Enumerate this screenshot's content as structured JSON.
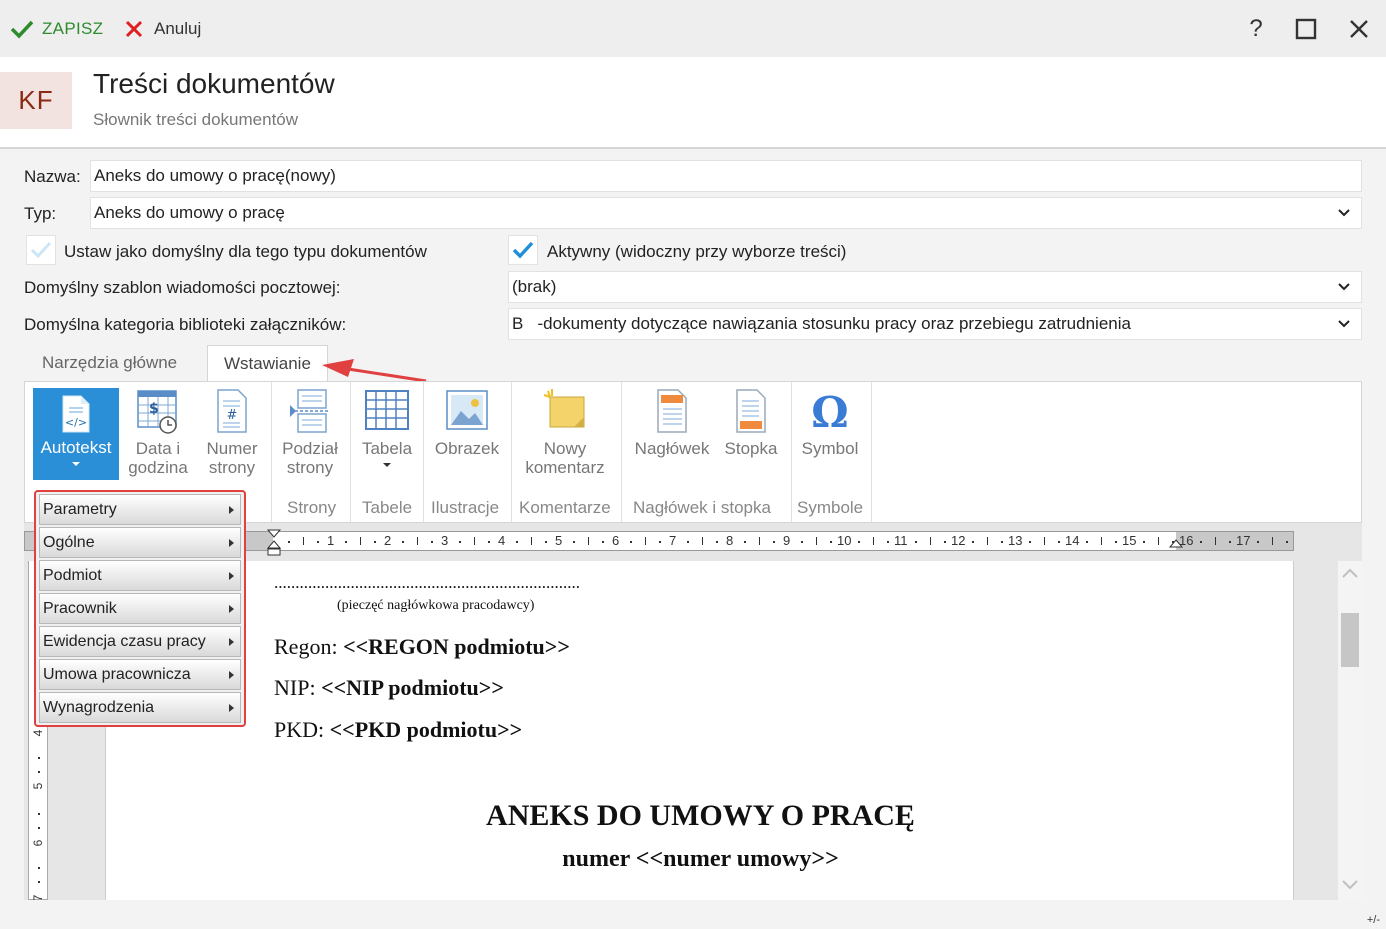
{
  "toolbar": {
    "save_label": "ZAPISZ",
    "cancel_label": "Anuluj"
  },
  "window_controls": {
    "help": "?"
  },
  "header": {
    "badge": "KF",
    "title": "Treści dokumentów",
    "subtitle": "Słownik treści dokumentów"
  },
  "form": {
    "name_label": "Nazwa:",
    "name_value": "Aneks do umowy o pracę(nowy)",
    "type_label": "Typ:",
    "type_value": "Aneks do umowy o pracę",
    "default_checkbox_label": "Ustaw jako domyślny dla tego typu dokumentów",
    "default_checked": false,
    "active_checkbox_label": "Aktywny (widoczny przy wyborze treści)",
    "active_checked": true,
    "mail_template_label": "Domyślny szablon wiadomości pocztowej:",
    "mail_template_value": "(brak)",
    "category_label": "Domyślna kategoria biblioteki załączników:",
    "category_value": "B   -dokumenty dotyczące nawiązania stosunku pracy oraz przebiegu zatrudnienia"
  },
  "tabs": [
    {
      "label": "Narzędzia główne",
      "active": false
    },
    {
      "label": "Wstawianie",
      "active": true
    }
  ],
  "ribbon": {
    "buttons": {
      "autotext": "Autotekst",
      "datetime_1": "Data i",
      "datetime_2": "godzina",
      "pagenum_1": "Numer",
      "pagenum_2": "strony",
      "pagebreak_1": "Podział",
      "pagebreak_2": "strony",
      "table": "Tabela",
      "image": "Obrazek",
      "comment_1": "Nowy",
      "comment_2": "komentarz",
      "header": "Nagłówek",
      "footer": "Stopka",
      "symbol": "Symbol"
    },
    "groups": {
      "pages": "Strony",
      "tables": "Tabele",
      "illustrations": "Ilustracje",
      "comments": "Komentarze",
      "header_footer": "Nagłówek i stopka",
      "symbols": "Symbole"
    }
  },
  "autotext_menu": [
    "Parametry",
    "Ogólne",
    "Podmiot",
    "Pracownik",
    "Ewidencja czasu pracy",
    "Umowa pracownicza",
    "Wynagrodzenia"
  ],
  "ruler": {
    "numbers": [
      "1",
      "2",
      "3",
      "4",
      "5",
      "6",
      "7",
      "8",
      "9",
      "10",
      "11",
      "12",
      "13",
      "14",
      "15",
      "16",
      "17"
    ],
    "vnumbers": [
      "4",
      "5",
      "6",
      "7"
    ]
  },
  "document": {
    "dots": "........................................................................",
    "stamp": "(pieczęć nagłówkowa pracodawcy)",
    "regon_label": "Regon: ",
    "regon_value": "<<REGON podmiotu>>",
    "nip_label": "NIP: ",
    "nip_value": "<<NIP podmiotu>>",
    "pkd_label": "PKD: ",
    "pkd_value": "<<PKD podmiotu>>",
    "title": "ANEKS DO UMOWY O PRACĘ",
    "number_line": "numer <<numer umowy>>"
  },
  "statusbar": {
    "zoom_toggle": "+/-"
  },
  "colors": {
    "accent_blue": "#2a8fd6",
    "save_green": "#2e8b2e",
    "cancel_red": "#e02020",
    "badge_text": "#8b2a14",
    "badge_bg": "#f3e3e0",
    "annotation_red": "#e04040"
  }
}
